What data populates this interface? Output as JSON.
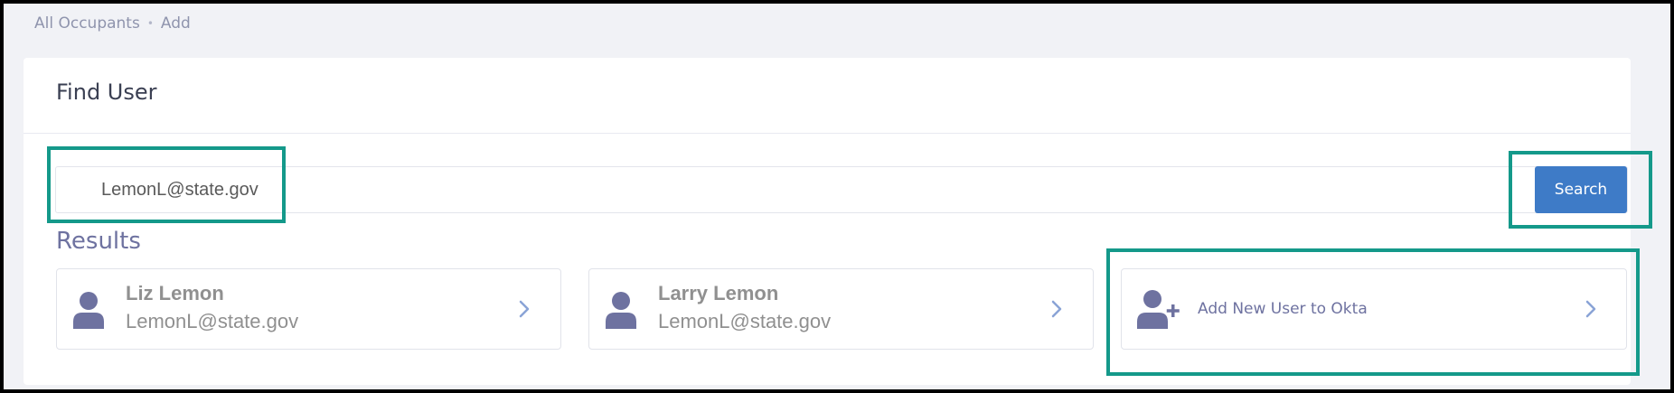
{
  "breadcrumb": {
    "items": [
      "All Occupants",
      "Add"
    ],
    "separator": "•"
  },
  "card": {
    "title": "Find User"
  },
  "search": {
    "value": "LemonL@state.gov",
    "button_label": "Search"
  },
  "results": {
    "title": "Results",
    "items": [
      {
        "name": "Liz Lemon",
        "email": "LemonL@state.gov",
        "icon": "user-icon"
      },
      {
        "name": "Larry Lemon",
        "email": "LemonL@state.gov",
        "icon": "user-icon"
      }
    ],
    "add_new": {
      "label": "Add New User to Okta",
      "icon": "user-plus-icon"
    }
  },
  "colors": {
    "accent": "#3e7bc7",
    "highlight": "#14998a",
    "icon": "#6e72a0",
    "frame": "#000000"
  }
}
